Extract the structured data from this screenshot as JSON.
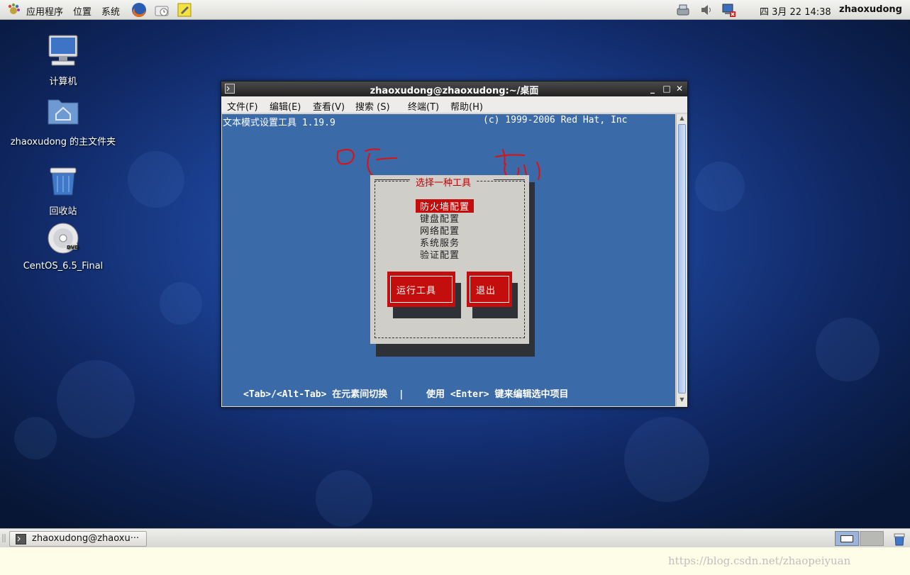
{
  "top_panel": {
    "menus": [
      "应用程序",
      "位置",
      "系统"
    ],
    "datetime": "四 3月 22 14:38",
    "username": "zhaoxudong"
  },
  "desktop": {
    "icons": [
      {
        "label": "计算机",
        "icon": "computer-icon"
      },
      {
        "label": "zhaoxudong 的主文件夹",
        "icon": "home-folder-icon"
      },
      {
        "label": "回收站",
        "icon": "trash-icon"
      },
      {
        "label": "CentOS_6.5_Final",
        "icon": "dvd-icon"
      }
    ]
  },
  "terminal": {
    "title": "zhaoxudong@zhaoxudong:~/桌面",
    "menu": [
      "文件(F)",
      "编辑(E)",
      "查看(V)",
      "搜索 (S)",
      "终端(T)",
      "帮助(H)"
    ],
    "header_left": "文本模式设置工具 1.19.9",
    "header_right": "(c) 1999-2006 Red Hat, Inc",
    "dialog": {
      "title": "选择一种工具",
      "options": [
        "防火墙配置",
        "键盘配置",
        "网络配置",
        "系统服务",
        "验证配置"
      ],
      "selected_index": 0,
      "run_button": "运行工具",
      "quit_button": "退出"
    },
    "help_line": "<Tab>/<Alt-Tab> 在元素间切换  |    使用 <Enter> 键来编辑选中项目"
  },
  "taskbar": {
    "task_label": "zhaoxudong@zhaoxu···"
  },
  "watermark": "https://blog.csdn.net/zhaopeiyuan",
  "colors": {
    "terminal_bg": "#3a6aa8",
    "dialog_bg": "#d0cec9",
    "accent_red": "#c40d0d",
    "annotation_red": "#e01010"
  }
}
